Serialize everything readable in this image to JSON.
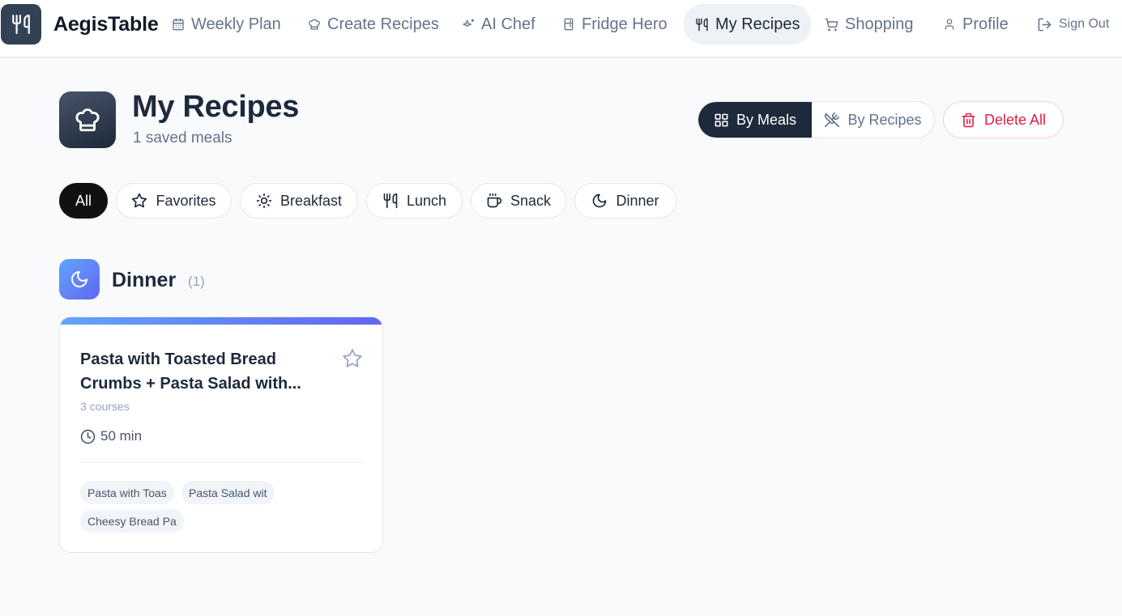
{
  "app": {
    "brand": "AegisTable"
  },
  "nav": {
    "weekly_plan": "Weekly Plan",
    "create_recipes": "Create Recipes",
    "ai_chef": "AI Chef",
    "fridge_hero": "Fridge Hero",
    "my_recipes": "My Recipes",
    "shopping": "Shopping",
    "profile": "Profile",
    "sign_out": "Sign Out"
  },
  "header": {
    "title": "My Recipes",
    "subtitle": "1 saved meals",
    "view_by_meals": "By Meals",
    "view_by_recipes": "By Recipes",
    "delete_all": "Delete All"
  },
  "filters": {
    "all": "All",
    "favorites": "Favorites",
    "breakfast": "Breakfast",
    "lunch": "Lunch",
    "snack": "Snack",
    "dinner": "Dinner"
  },
  "section": {
    "title": "Dinner",
    "count": "(1)"
  },
  "card": {
    "title": "Pasta with Toasted Bread Crumbs + Pasta Salad with...",
    "courses": "3 courses",
    "time": "50 min",
    "tags": [
      "Pasta with Toas",
      "Pasta Salad wit",
      "Cheesy Bread Pa"
    ]
  },
  "colors": {
    "primary_dark": "#1e293b",
    "muted": "#64748b",
    "danger": "#e11d48",
    "dinner_gradient_start": "#60a5fa",
    "dinner_gradient_end": "#6366f1"
  },
  "icons": {
    "logo": "utensils-icon",
    "weekly_plan": "calendar-icon",
    "create_recipes": "chef-hat-icon",
    "ai_chef": "sparkles-icon",
    "fridge_hero": "fridge-icon",
    "my_recipes": "utensils-icon",
    "shopping": "cart-icon",
    "profile": "user-icon",
    "sign_out": "log-out-icon"
  }
}
